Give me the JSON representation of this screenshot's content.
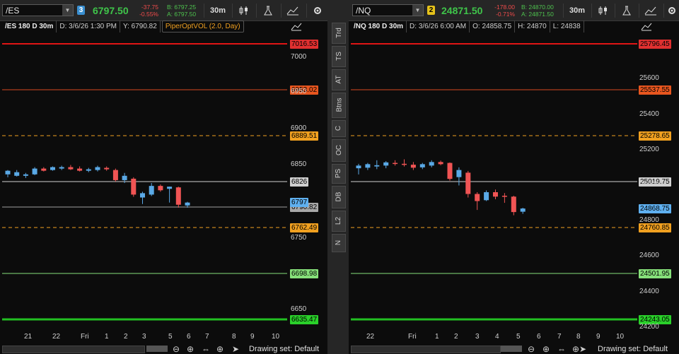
{
  "sidebar_tabs": [
    "Trd",
    "TS",
    "AT",
    "Btns",
    "C",
    "OC",
    "PS",
    "DB",
    "L2",
    "N"
  ],
  "footer": {
    "drawing_set": "Drawing set: Default"
  },
  "charts": [
    {
      "symbol": "/ES",
      "link_number": "3",
      "link_color": "#3a8fd0",
      "last": "6797.50",
      "net_change": "-37.75",
      "pct_change": "-0.55%",
      "bid": "B: 6797.25",
      "ask": "A: 6797.50",
      "timeframe": "30m",
      "header": "/ES 180 D 30m",
      "date": "D: 3/6/26 1:30 PM",
      "y_value": "Y: 6790.82",
      "study": "PiperOptVOL (2.0, Day)",
      "status_extra": [],
      "y_axis": [
        "7000",
        "6950",
        "6900",
        "6850",
        "6750",
        "6650"
      ],
      "x_axis": [
        "21",
        "22",
        "Fri",
        "1",
        "2",
        "3",
        "5",
        "6",
        "7",
        "8",
        "9",
        "10"
      ],
      "levels": [
        {
          "price": "7016.53",
          "color": "#e01515",
          "style": "solid",
          "width": 2,
          "tag_bg": "#e03030"
        },
        {
          "price": "6953.02",
          "color": "#d9481f",
          "style": "solid",
          "width": 1,
          "tag_bg": "#e8561f"
        },
        {
          "price": "6889.51",
          "color": "#f0a020",
          "style": "dash",
          "width": 1,
          "tag_bg": "#f0a020"
        },
        {
          "price": "6826",
          "color": "#cfcfcf",
          "style": "solid",
          "width": 1,
          "tag_bg": "#cfcfcf"
        },
        {
          "price": "6790.82",
          "color": "#a0a0a0",
          "style": "solid",
          "width": 1,
          "tag_bg": "#a8a8a8"
        },
        {
          "price": "6762.49",
          "color": "#f0a020",
          "style": "dash",
          "width": 1,
          "tag_bg": "#f0a020"
        },
        {
          "price": "6698.98",
          "color": "#86e07a",
          "style": "solid",
          "width": 1,
          "tag_bg": "#86e07a"
        },
        {
          "price": "6635.47",
          "color": "#22c022",
          "style": "solid",
          "width": 3,
          "tag_bg": "#2ad02a"
        }
      ],
      "last_price_tag": "6797",
      "chart_data": {
        "type": "candlestick",
        "ylim": [
          6625,
          7030
        ],
        "candles": [
          {
            "o": 6836,
            "h": 6842,
            "l": 6832,
            "c": 6841
          },
          {
            "o": 6834,
            "h": 6842,
            "l": 6833,
            "c": 6839
          },
          {
            "o": 6834,
            "h": 6838,
            "l": 6831,
            "c": 6836
          },
          {
            "o": 6836,
            "h": 6846,
            "l": 6835,
            "c": 6844
          },
          {
            "o": 6844,
            "h": 6846,
            "l": 6840,
            "c": 6841
          },
          {
            "o": 6842,
            "h": 6847,
            "l": 6841,
            "c": 6846
          },
          {
            "o": 6844,
            "h": 6848,
            "l": 6842,
            "c": 6846
          },
          {
            "o": 6846,
            "h": 6849,
            "l": 6842,
            "c": 6843
          },
          {
            "o": 6844,
            "h": 6847,
            "l": 6840,
            "c": 6841
          },
          {
            "o": 6841,
            "h": 6845,
            "l": 6839,
            "c": 6843
          },
          {
            "o": 6842,
            "h": 6848,
            "l": 6840,
            "c": 6846
          },
          {
            "o": 6845,
            "h": 6847,
            "l": 6841,
            "c": 6843
          },
          {
            "o": 6842,
            "h": 6844,
            "l": 6826,
            "c": 6828
          },
          {
            "o": 6828,
            "h": 6838,
            "l": 6824,
            "c": 6834
          },
          {
            "o": 6830,
            "h": 6832,
            "l": 6805,
            "c": 6808
          },
          {
            "o": 6804,
            "h": 6812,
            "l": 6795,
            "c": 6810
          },
          {
            "o": 6808,
            "h": 6824,
            "l": 6806,
            "c": 6820
          },
          {
            "o": 6820,
            "h": 6822,
            "l": 6812,
            "c": 6814
          },
          {
            "o": 6816,
            "h": 6819,
            "l": 6797,
            "c": 6819
          },
          {
            "o": 6818,
            "h": 6819,
            "l": 6790,
            "c": 6794
          },
          {
            "o": 6793,
            "h": 6798,
            "l": 6790,
            "c": 6797
          }
        ]
      }
    },
    {
      "symbol": "/NQ",
      "link_number": "2",
      "link_color": "#e6c21a",
      "last": "24871.50",
      "net_change": "-178.00",
      "pct_change": "-0.71%",
      "bid": "B: 24870.00",
      "ask": "A: 24871.50",
      "timeframe": "30m",
      "header": "/NQ 180 D 30m",
      "date": "D: 3/6/26 6:00 AM",
      "y_value": "",
      "study": "",
      "status_extra": [
        "O: 24858.75",
        "H: 24870",
        "L: 24838"
      ],
      "y_axis": [
        "25600",
        "25400",
        "25200",
        "25000",
        "24800",
        "24600",
        "24400",
        "24200"
      ],
      "x_axis": [
        "22",
        "Fri",
        "1",
        "2",
        "3",
        "4",
        "5",
        "6",
        "7",
        "8",
        "9",
        "10"
      ],
      "levels": [
        {
          "price": "25796.45",
          "color": "#e01515",
          "style": "solid",
          "width": 2,
          "tag_bg": "#e03030"
        },
        {
          "price": "25537.55",
          "color": "#d9481f",
          "style": "solid",
          "width": 1,
          "tag_bg": "#e8561f"
        },
        {
          "price": "25278.65",
          "color": "#f0a020",
          "style": "dash",
          "width": 1,
          "tag_bg": "#f0a020"
        },
        {
          "price": "25019.75",
          "color": "#cfcfcf",
          "style": "solid",
          "width": 1,
          "tag_bg": "#cfcfcf"
        },
        {
          "price": "24760.85",
          "color": "#f0a020",
          "style": "dash",
          "width": 1,
          "tag_bg": "#f0a020"
        },
        {
          "price": "24501.95",
          "color": "#86e07a",
          "style": "solid",
          "width": 1,
          "tag_bg": "#86e07a"
        },
        {
          "price": "24243.05",
          "color": "#22c022",
          "style": "solid",
          "width": 3,
          "tag_bg": "#2ad02a"
        }
      ],
      "last_price_tag": "24868.75",
      "chart_data": {
        "type": "candlestick",
        "ylim": [
          24200,
          25830
        ],
        "candles": [
          {
            "o": 25095,
            "h": 25120,
            "l": 25060,
            "c": 25110
          },
          {
            "o": 25098,
            "h": 25125,
            "l": 25085,
            "c": 25118
          },
          {
            "o": 25105,
            "h": 25140,
            "l": 25090,
            "c": 25112
          },
          {
            "o": 25110,
            "h": 25135,
            "l": 25095,
            "c": 25128
          },
          {
            "o": 25125,
            "h": 25140,
            "l": 25110,
            "c": 25120
          },
          {
            "o": 25120,
            "h": 25145,
            "l": 25105,
            "c": 25115
          },
          {
            "o": 25115,
            "h": 25130,
            "l": 25085,
            "c": 25098
          },
          {
            "o": 25100,
            "h": 25125,
            "l": 25090,
            "c": 25118
          },
          {
            "o": 25110,
            "h": 25140,
            "l": 25100,
            "c": 25130
          },
          {
            "o": 25130,
            "h": 25138,
            "l": 25112,
            "c": 25118
          },
          {
            "o": 25125,
            "h": 25128,
            "l": 25025,
            "c": 25035
          },
          {
            "o": 25045,
            "h": 25100,
            "l": 24998,
            "c": 25085
          },
          {
            "o": 25070,
            "h": 25080,
            "l": 24930,
            "c": 24950
          },
          {
            "o": 24950,
            "h": 24960,
            "l": 24860,
            "c": 24910
          },
          {
            "o": 24915,
            "h": 24970,
            "l": 24910,
            "c": 24960
          },
          {
            "o": 24960,
            "h": 24975,
            "l": 24920,
            "c": 24935
          },
          {
            "o": 24940,
            "h": 24955,
            "l": 24900,
            "c": 24935
          },
          {
            "o": 24935,
            "h": 24940,
            "l": 24830,
            "c": 24848
          },
          {
            "o": 24850,
            "h": 24872,
            "l": 24838,
            "c": 24868
          }
        ]
      }
    }
  ]
}
